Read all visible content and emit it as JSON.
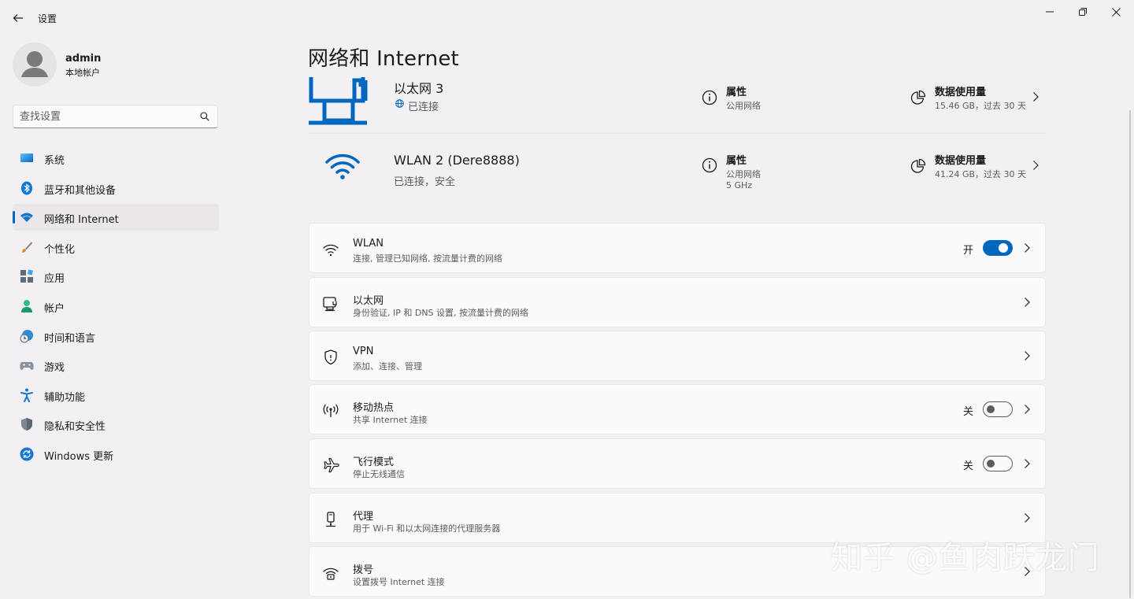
{
  "window": {
    "title": "设置"
  },
  "user": {
    "name": "admin",
    "account_type": "本地帐户"
  },
  "search": {
    "placeholder": "查找设置"
  },
  "nav": [
    {
      "label": "系统",
      "icon": "system-icon"
    },
    {
      "label": "蓝牙和其他设备",
      "icon": "bluetooth-icon"
    },
    {
      "label": "网络和 Internet",
      "icon": "wifi-icon",
      "active": true
    },
    {
      "label": "个性化",
      "icon": "brush-icon"
    },
    {
      "label": "应用",
      "icon": "apps-icon"
    },
    {
      "label": "帐户",
      "icon": "person-icon"
    },
    {
      "label": "时间和语言",
      "icon": "clock-globe-icon"
    },
    {
      "label": "游戏",
      "icon": "gamepad-icon"
    },
    {
      "label": "辅助功能",
      "icon": "accessibility-icon"
    },
    {
      "label": "隐私和安全性",
      "icon": "shield-icon"
    },
    {
      "label": "Windows 更新",
      "icon": "update-icon"
    }
  ],
  "page": {
    "title": "网络和 Internet"
  },
  "connections": [
    {
      "name": "以太网 3",
      "status": "已连接",
      "properties_label": "属性",
      "properties_sub": [
        "公用网络"
      ],
      "data_label": "数据使用量",
      "data_sub": "15.46 GB，过去 30 天"
    },
    {
      "name": "WLAN 2 (Dere8888)",
      "status": "已连接，安全",
      "properties_label": "属性",
      "properties_sub": [
        "公用网络",
        "5 GHz"
      ],
      "data_label": "数据使用量",
      "data_sub": "41.24 GB，过去 30 天"
    }
  ],
  "cards": [
    {
      "title": "WLAN",
      "sub": "连接, 管理已知网络, 按流量计费的网络",
      "toggle": "开",
      "toggle_on": true,
      "icon": "wifi-icon"
    },
    {
      "title": "以太网",
      "sub": "身份验证, IP 和 DNS 设置, 按流量计费的网络",
      "icon": "ethernet-icon"
    },
    {
      "title": "VPN",
      "sub": "添加、连接、管理",
      "icon": "vpn-shield-icon"
    },
    {
      "title": "移动热点",
      "sub": "共享 Internet 连接",
      "toggle": "关",
      "toggle_on": false,
      "icon": "hotspot-icon"
    },
    {
      "title": "飞行模式",
      "sub": "停止无线通信",
      "toggle": "关",
      "toggle_on": false,
      "icon": "airplane-icon"
    },
    {
      "title": "代理",
      "sub": "用于 Wi-Fi 和以太网连接的代理服务器",
      "icon": "proxy-icon"
    },
    {
      "title": "拨号",
      "sub": "设置拨号 Internet 连接",
      "icon": "dialup-icon"
    }
  ],
  "watermark": "知乎 @鱼肉跃龙门",
  "colors": {
    "accent": "#0067c0",
    "background": "#f3f0f3",
    "card": "#fbfafb"
  }
}
